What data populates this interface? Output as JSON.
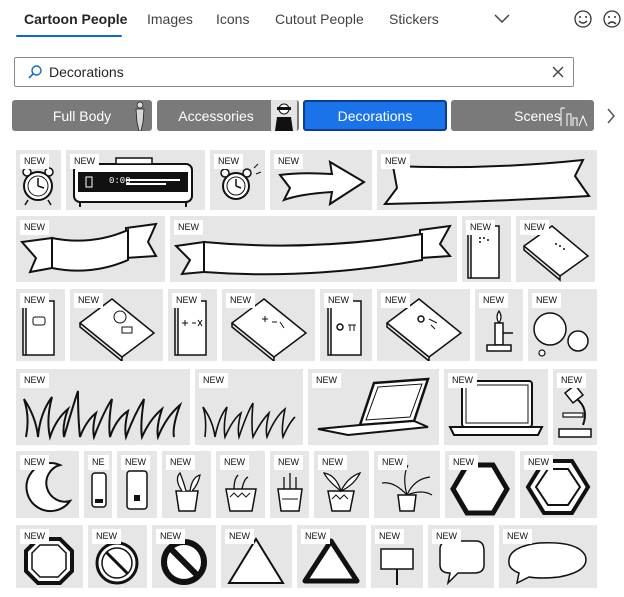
{
  "tabs": [
    "Cartoon People",
    "Images",
    "Icons",
    "Cutout People",
    "Stickers"
  ],
  "search": {
    "value": "Decorations"
  },
  "categories": [
    "Full Body",
    "Accessories",
    "Decorations",
    "Scenes"
  ],
  "badge": "NEW",
  "badge_partial": "NE",
  "alarm_display": "0:00",
  "colors": {
    "accent": "#0f6cbd",
    "selected_category": "#1a73e8",
    "category": "#7a7a7a",
    "tile": "#e6e6e6"
  }
}
